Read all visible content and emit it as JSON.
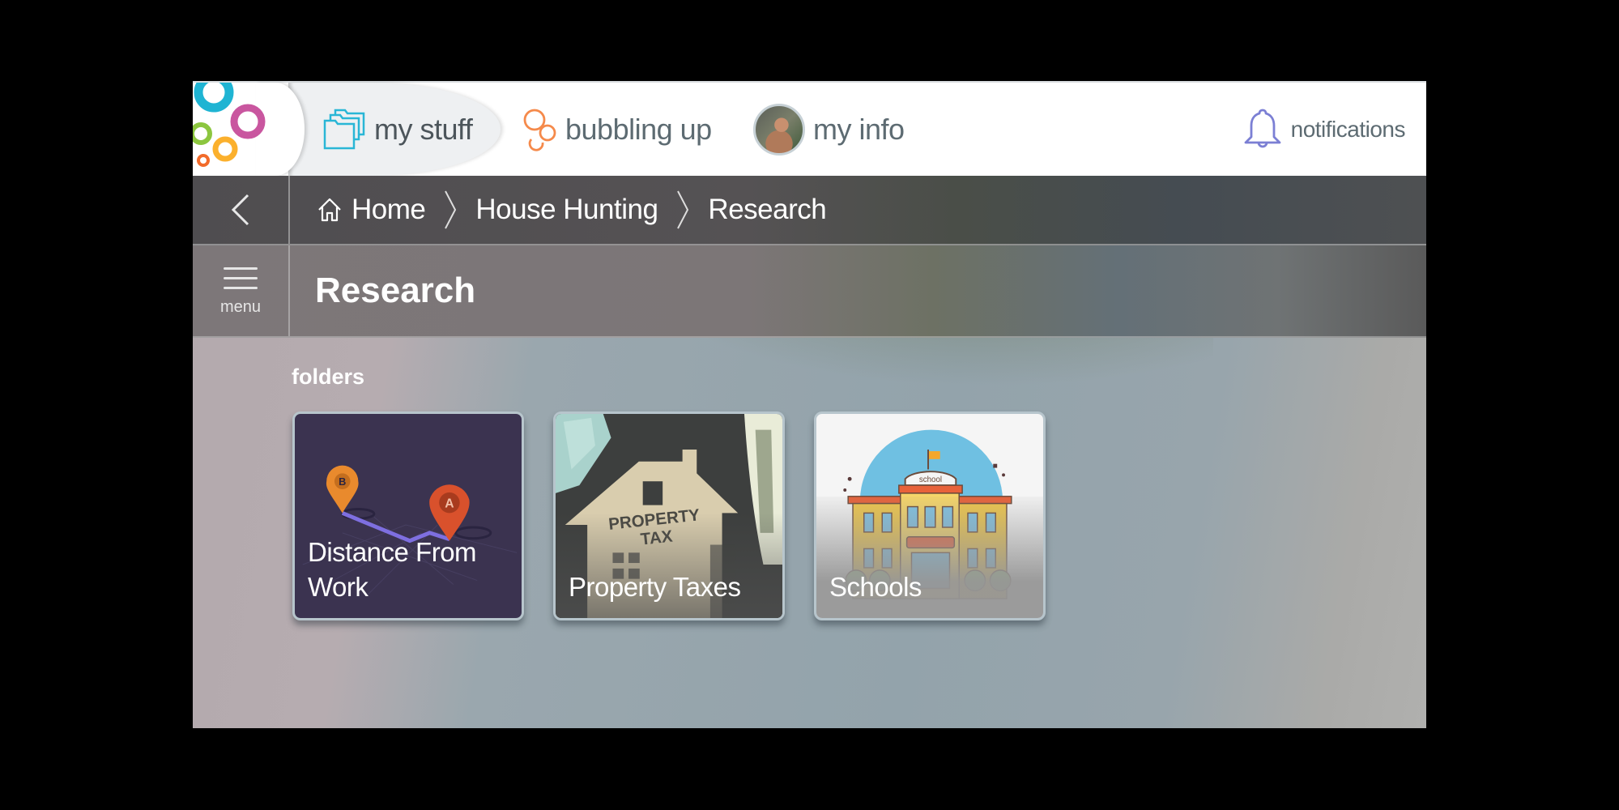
{
  "nav": {
    "logo": "bubbling-circles-logo",
    "tabs": [
      {
        "label": "my stuff",
        "icon": "folders-icon",
        "active": true
      },
      {
        "label": "bubbling up",
        "icon": "bubbles-icon",
        "active": false
      },
      {
        "label": "my info",
        "icon": "avatar",
        "active": false
      }
    ],
    "notifications": {
      "label": "notifications",
      "icon": "bell-icon"
    }
  },
  "breadcrumb": {
    "back_icon": "chevron-left-icon",
    "items": [
      {
        "label": "Home",
        "icon": "home-icon"
      },
      {
        "label": "House Hunting"
      },
      {
        "label": "Research"
      }
    ]
  },
  "header": {
    "menu_label": "menu",
    "title": "Research"
  },
  "content": {
    "section_label": "folders",
    "folders": [
      {
        "label": "Distance From Work",
        "image": "map-pins-route"
      },
      {
        "label": "Property Taxes",
        "image": "property-tax-house"
      },
      {
        "label": "Schools",
        "image": "school-building"
      }
    ]
  },
  "colors": {
    "logo_blue": "#1fb4d3",
    "logo_magenta": "#c9569f",
    "logo_green": "#8cc63f",
    "logo_yellow": "#fbb02d",
    "logo_orange": "#f26b2a",
    "folder_icon": "#29b6d6",
    "bubbles_icon": "#f58a4b",
    "bell_icon": "#7b7fd4"
  }
}
